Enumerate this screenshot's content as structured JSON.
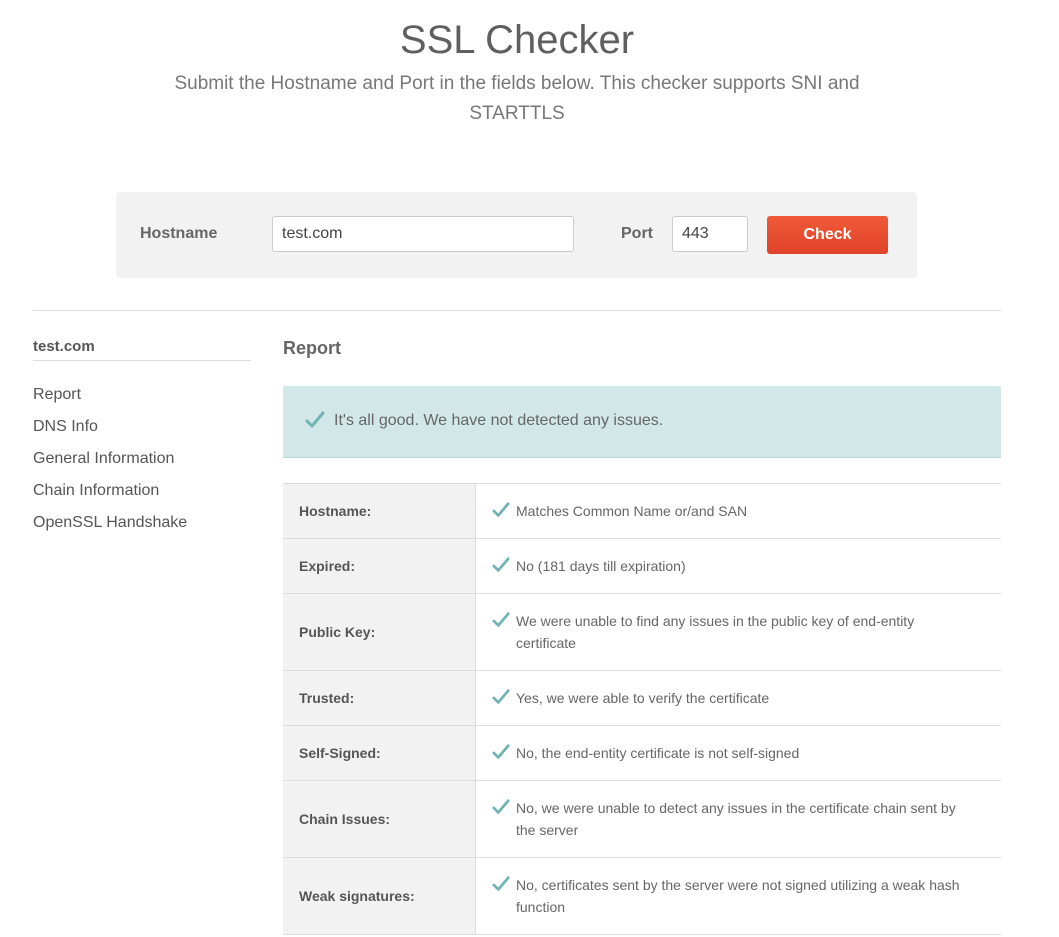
{
  "header": {
    "title": "SSL Checker",
    "subtitle": "Submit the Hostname and Port in the fields below. This checker supports SNI and STARTTLS"
  },
  "form": {
    "hostname_label": "Hostname",
    "hostname_value": "test.com",
    "port_label": "Port",
    "port_value": "443",
    "check_label": "Check"
  },
  "sidebar": {
    "title": "test.com",
    "items": [
      {
        "label": "Report"
      },
      {
        "label": "DNS Info"
      },
      {
        "label": "General Information"
      },
      {
        "label": "Chain Information"
      },
      {
        "label": "OpenSSL Handshake"
      }
    ]
  },
  "report": {
    "heading": "Report",
    "alert": "It's all good. We have not detected any issues.",
    "rows": [
      {
        "label": "Hostname:",
        "value": "Matches Common Name or/and SAN"
      },
      {
        "label": "Expired:",
        "value": "No (181 days till expiration)"
      },
      {
        "label": "Public Key:",
        "value": "We were unable to find any issues in the public key of end-entity certificate"
      },
      {
        "label": "Trusted:",
        "value": "Yes, we were able to verify the certificate"
      },
      {
        "label": "Self-Signed:",
        "value": "No, the end-entity certificate is not self-signed"
      },
      {
        "label": "Chain Issues:",
        "value": "No, we were unable to detect any issues in the certificate chain sent by the server"
      },
      {
        "label": "Weak signatures:",
        "value": "No, certificates sent by the server were not signed utilizing a weak hash function"
      }
    ]
  },
  "colors": {
    "accent": "#e84c2e",
    "check_icon": "#6fb3b3",
    "alert_background": "#d2e7e8"
  },
  "icons": {
    "checkmark": "check-icon"
  }
}
